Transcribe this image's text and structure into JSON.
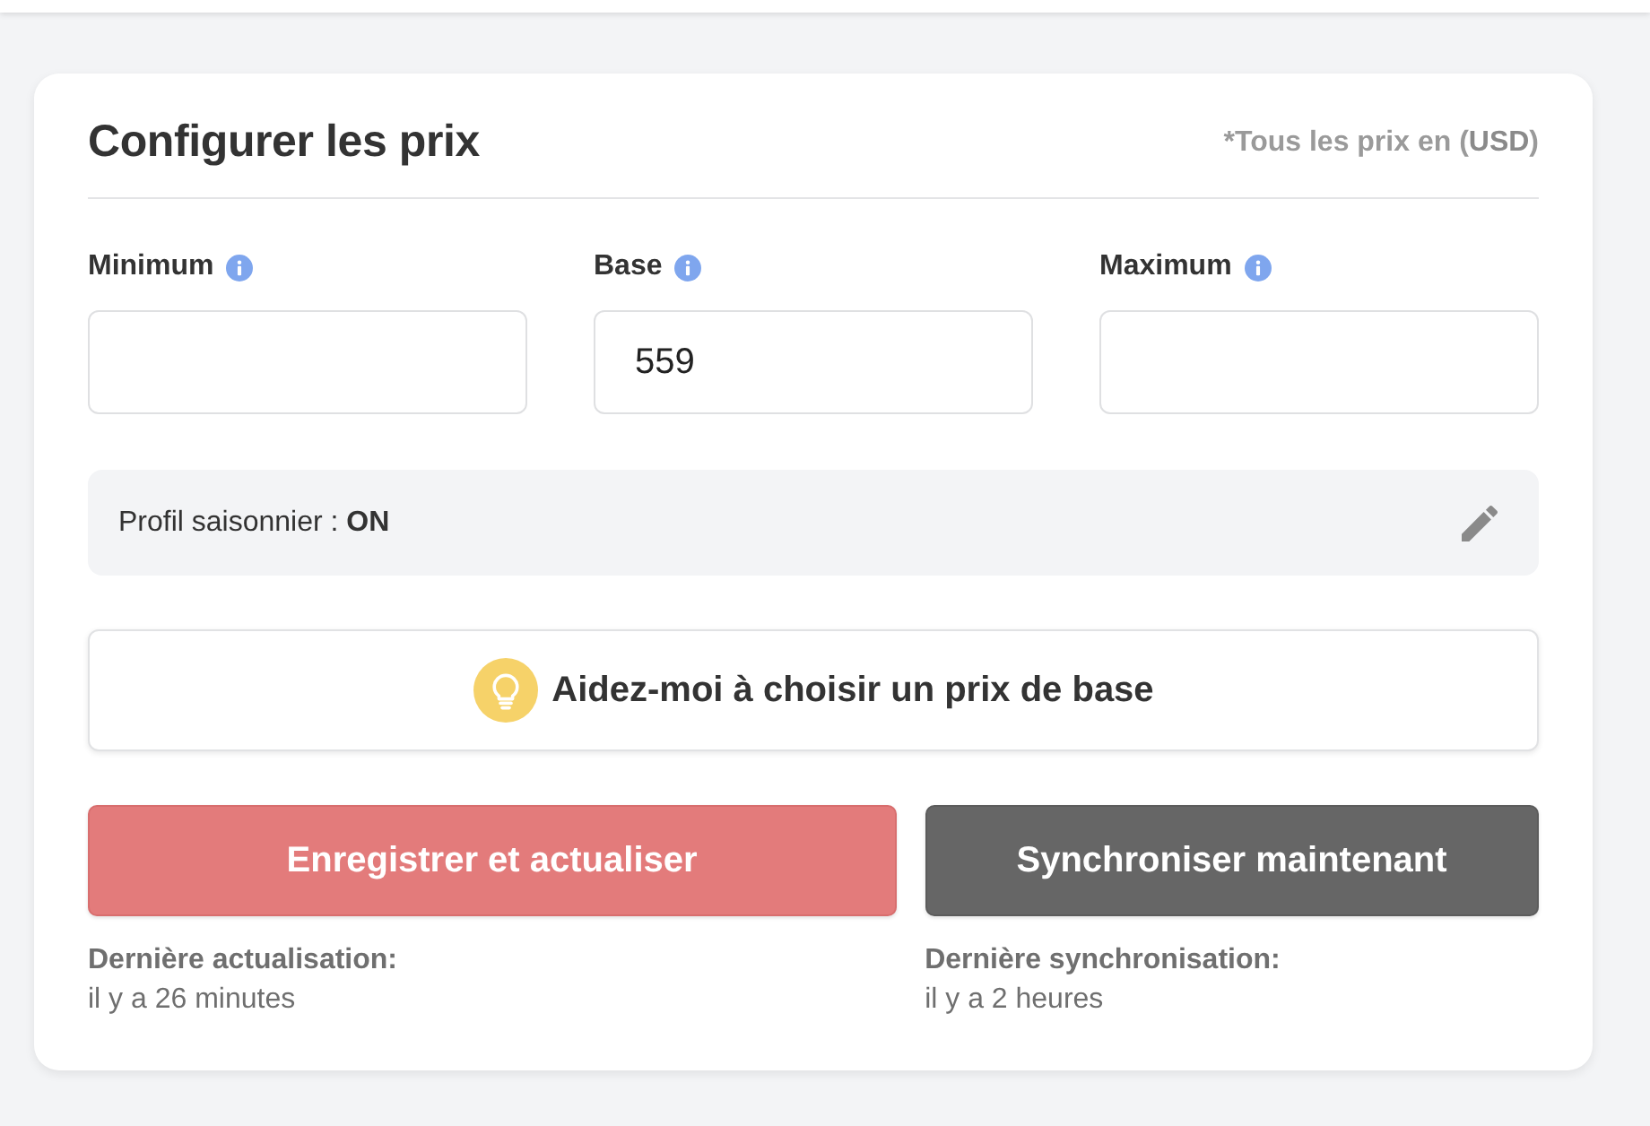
{
  "header": {
    "title": "Configurer les prix",
    "currency_note": "*Tous les prix en (**USD**)"
  },
  "price_fields": [
    {
      "label": "Minimum"
    },
    {
      "label": "Base",
      "value": "559"
    },
    {
      "label": "Maximum"
    }
  ],
  "seasonal_profile": {
    "text": "Profil saisonnier : **ON**"
  },
  "help_button": {
    "label": "Aidez-moi à choisir un prix de base"
  },
  "actions": [
    {
      "kind": "save",
      "label": "Enregistrer et actualiser",
      "caption": "Dernière actualisation:",
      "time": "il y a 26 minutes"
    },
    {
      "kind": "sync",
      "label": "Synchroniser maintenant",
      "caption": "Dernière synchronisation:",
      "time": "il y a 2 heures"
    }
  ]
}
